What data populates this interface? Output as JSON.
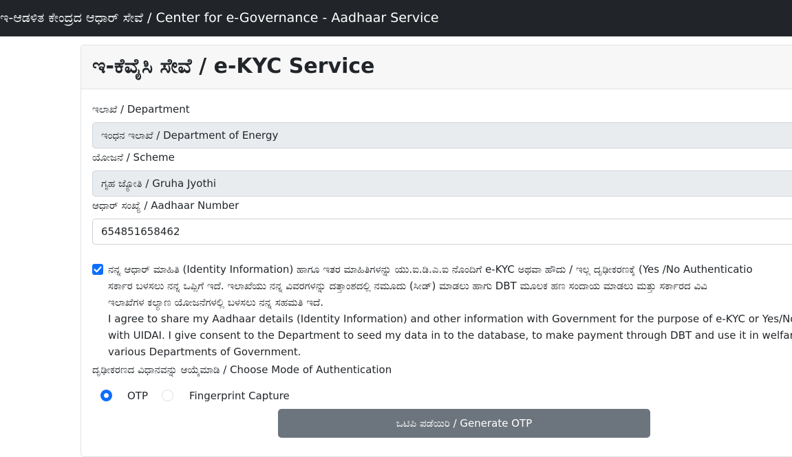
{
  "topbar": {
    "title": "ಇ-ಆಡಳಿತ ಕೇಂದ್ರದ ಆಧಾರ್ ಸೇವೆ / Center for e-Governance - Aadhaar Service"
  },
  "card": {
    "title": "ಇ-ಕೆವೈಸಿ ಸೇವೆ / e-KYC Service"
  },
  "form": {
    "department": {
      "label": "ಇಲಾಖೆ / Department",
      "value": "ಇಂಧನ ಇಲಾಖೆ / Department of Energy"
    },
    "scheme": {
      "label": "ಯೋಜನೆ / Scheme",
      "value": "ಗೃಹ ಜ್ಯೋತಿ / Gruha Jyothi"
    },
    "aadhaar": {
      "label": "ಆಧಾರ್ ಸಂಖ್ಯೆ / Aadhaar Number",
      "value": "654851658462"
    },
    "consent": {
      "checked": true,
      "lines": [
        "ನನ್ನ ಆಧಾರ್ ಮಾಹಿತಿ (Identity Information) ಹಾಗೂ ಇತರ ಮಾಹಿತಿಗಳನ್ನು ಯು.ಐ.ಡಿ.ಎ.ಐ ನೊಂದಿಗೆ e-KYC ಅಥವಾ ಹೌದು / ಇಲ್ಲ ದೃಢೀಕರಣಕ್ಕೆ (Yes /No Authenticatio",
        "ಸರ್ಕಾರ ಬಳಸಲು ನನ್ನ ಒಪ್ಪಿಗೆ ಇದೆ. ಇಲಾಖೆಯು ನನ್ನ ವಿವರಗಳನ್ನು ದತ್ತಾಂಶದಲ್ಲಿ ನಮೂದು (ಸೀಡ್) ಮಾಡಲು ಹಾಗು DBT ಮೂಲಕ ಹಣ ಸಂದಾಯ ಮಾಡಲು ಮತ್ತು ಸರ್ಕಾರದ ವಿವಿ",
        "ಇಲಾಖೆಗಳ ಕಲ್ಯಾಣ ಯೋಜನೆಗಳಲ್ಲಿ ಬಳಸಲು ನನ್ನ ಸಹಮತಿ ಇದೆ.",
        "I agree to share my Aadhaar details (Identity Information) and other information with Government for the purpose of e-KYC or Yes/No Authen",
        "with UIDAI. I give consent to the Department to seed my data in to the database, to make payment through DBT and use it in welfare scheme",
        "various Departments of Government."
      ]
    },
    "auth_mode": {
      "label": "ದೃಢೀಕರಣದ ವಿಧಾನವನ್ನು ಆಯ್ಕೆಮಾಡಿ / Choose Mode of Authentication",
      "options": [
        {
          "label": "OTP",
          "selected": true
        },
        {
          "label": "Fingerprint Capture",
          "selected": false
        }
      ]
    },
    "submit_label": "ಒಟಿಪಿ ಪಡೆಯಿರಿ / Generate OTP"
  },
  "colors": {
    "topbar": "#212529",
    "accent": "#0d6efd",
    "button": "#6c757d",
    "readonly_bg": "#e9ecef"
  },
  "icons": {
    "checkbox": "check-icon"
  }
}
